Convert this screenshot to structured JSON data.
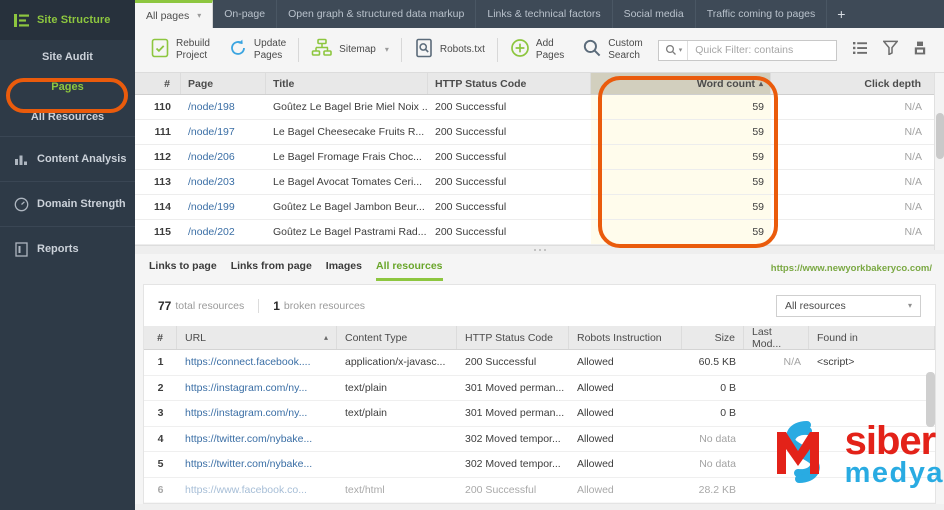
{
  "colors": {
    "brand_green": "#8dc63f",
    "sidebar_bg": "#2e3a47",
    "highlight_ring": "#ea5b0c",
    "sorted_header": "#d2cfbe",
    "sorted_cell": "#fffcec",
    "logo_red": "#e32219",
    "logo_blue": "#29abe2",
    "link_blue": "#3a6ea5"
  },
  "sidebar": {
    "header": {
      "label": "Site Structure",
      "icon": "site-structure-icon"
    },
    "sub_items": [
      {
        "label": "Site Audit",
        "active": false
      },
      {
        "label": "Pages",
        "active": true
      },
      {
        "label": "All Resources",
        "active": false
      }
    ],
    "items": [
      {
        "label": "Content Analysis",
        "icon": "bar-chart-icon"
      },
      {
        "label": "Domain Strength",
        "icon": "gauge-icon"
      },
      {
        "label": "Reports",
        "icon": "report-icon"
      }
    ]
  },
  "tabs": [
    {
      "label": "All pages",
      "active": true,
      "caret": "▾"
    },
    {
      "label": "On-page",
      "active": false
    },
    {
      "label": "Open graph & structured data markup",
      "active": false
    },
    {
      "label": "Links & technical factors",
      "active": false
    },
    {
      "label": "Social media",
      "active": false
    },
    {
      "label": "Traffic coming to pages",
      "active": false
    }
  ],
  "tab_add_label": "+",
  "toolbar": {
    "buttons": [
      {
        "line1": "Rebuild",
        "line2": "Project",
        "icon": "rebuild-project-icon",
        "caret": false
      },
      {
        "line1": "Update",
        "line2": "Pages",
        "icon": "update-pages-icon",
        "caret": false
      },
      {
        "line1": "Sitemap",
        "line2": "",
        "icon": "sitemap-icon",
        "caret": true
      },
      {
        "line1": "Robots.txt",
        "line2": "",
        "icon": "robots-txt-icon",
        "caret": false
      },
      {
        "line1": "Add",
        "line2": "Pages",
        "icon": "add-pages-icon",
        "caret": false
      },
      {
        "line1": "Custom",
        "line2": "Search",
        "icon": "custom-search-icon",
        "caret": false
      }
    ],
    "filter": {
      "placeholder": "Quick Filter: contains",
      "value": ""
    },
    "right_icons": [
      "columns-list-icon",
      "filter-funnel-icon",
      "export-icon"
    ]
  },
  "pages_grid": {
    "columns": [
      {
        "key": "num",
        "label": "#",
        "sorted": false
      },
      {
        "key": "page",
        "label": "Page",
        "sorted": false
      },
      {
        "key": "title",
        "label": "Title",
        "sorted": false
      },
      {
        "key": "http",
        "label": "HTTP Status Code",
        "sorted": false
      },
      {
        "key": "words",
        "label": "Word count",
        "sorted": true,
        "sort_dir": "▴"
      },
      {
        "key": "depth",
        "label": "Click depth",
        "sorted": false
      }
    ],
    "rows": [
      {
        "num": "110",
        "page": "/node/198",
        "title": "Goûtez Le Bagel Brie Miel Noix ...",
        "http": "200 Successful",
        "words": "59",
        "depth": "N/A"
      },
      {
        "num": "111",
        "page": "/node/197",
        "title": "Le Bagel Cheesecake Fruits R...",
        "http": "200 Successful",
        "words": "59",
        "depth": "N/A"
      },
      {
        "num": "112",
        "page": "/node/206",
        "title": "Le Bagel Fromage Frais Choc...",
        "http": "200 Successful",
        "words": "59",
        "depth": "N/A"
      },
      {
        "num": "113",
        "page": "/node/203",
        "title": "Le Bagel Avocat Tomates Ceri...",
        "http": "200 Successful",
        "words": "59",
        "depth": "N/A"
      },
      {
        "num": "114",
        "page": "/node/199",
        "title": "Goûtez Le Bagel Jambon Beur...",
        "http": "200 Successful",
        "words": "59",
        "depth": "N/A"
      },
      {
        "num": "115",
        "page": "/node/202",
        "title": "Goûtez Le Bagel Pastrami Rad...",
        "http": "200 Successful",
        "words": "59",
        "depth": "N/A"
      }
    ]
  },
  "bottom_panel": {
    "tabs": [
      {
        "label": "Links to page",
        "active": false
      },
      {
        "label": "Links from page",
        "active": false
      },
      {
        "label": "Images",
        "active": false
      },
      {
        "label": "All resources",
        "active": true
      }
    ],
    "page_url": "https://www.newyorkbakeryco.com/",
    "summary": {
      "total_count": "77",
      "total_label": "total resources",
      "broken_count": "1",
      "broken_label": "broken resources"
    },
    "filter_select": {
      "value": "All resources",
      "caret": "▾"
    },
    "columns": [
      {
        "key": "num",
        "label": "#",
        "sorted": false
      },
      {
        "key": "url",
        "label": "URL",
        "sorted": true,
        "sort_dir": "▴"
      },
      {
        "key": "ctype",
        "label": "Content Type",
        "sorted": false
      },
      {
        "key": "http",
        "label": "HTTP Status Code",
        "sorted": false
      },
      {
        "key": "robot",
        "label": "Robots Instruction",
        "sorted": false
      },
      {
        "key": "size",
        "label": "Size",
        "sorted": false
      },
      {
        "key": "mod",
        "label": "Last Mod...",
        "sorted": false
      },
      {
        "key": "found",
        "label": "Found in",
        "sorted": false
      }
    ],
    "rows": [
      {
        "num": "1",
        "url": "https://connect.facebook....",
        "ctype": "application/x-javasc...",
        "http": "200 Successful",
        "robot": "Allowed",
        "size": "60.5 KB",
        "mod": "N/A",
        "found": "<script>"
      },
      {
        "num": "2",
        "url": "https://instagram.com/ny...",
        "ctype": "text/plain",
        "http": "301 Moved perman...",
        "robot": "Allowed",
        "size": "0 B",
        "mod": "",
        "found": ""
      },
      {
        "num": "3",
        "url": "https://instagram.com/ny...",
        "ctype": "text/plain",
        "http": "301 Moved perman...",
        "robot": "Allowed",
        "size": "0 B",
        "mod": "",
        "found": ""
      },
      {
        "num": "4",
        "url": "https://twitter.com/nybake...",
        "ctype": "",
        "http": "302 Moved tempor...",
        "robot": "Allowed",
        "size": "No data",
        "mod": "",
        "found": ""
      },
      {
        "num": "5",
        "url": "https://twitter.com/nybake...",
        "ctype": "",
        "http": "302 Moved tempor...",
        "robot": "Allowed",
        "size": "No data",
        "mod": "",
        "found": ""
      },
      {
        "num": "6",
        "url": "https://www.facebook.co...",
        "ctype": "text/html",
        "http": "200 Successful",
        "robot": "Allowed",
        "size": "28.2 KB",
        "mod": "",
        "found": ""
      }
    ]
  },
  "watermark": {
    "word1": "siber",
    "word2": "medya"
  }
}
